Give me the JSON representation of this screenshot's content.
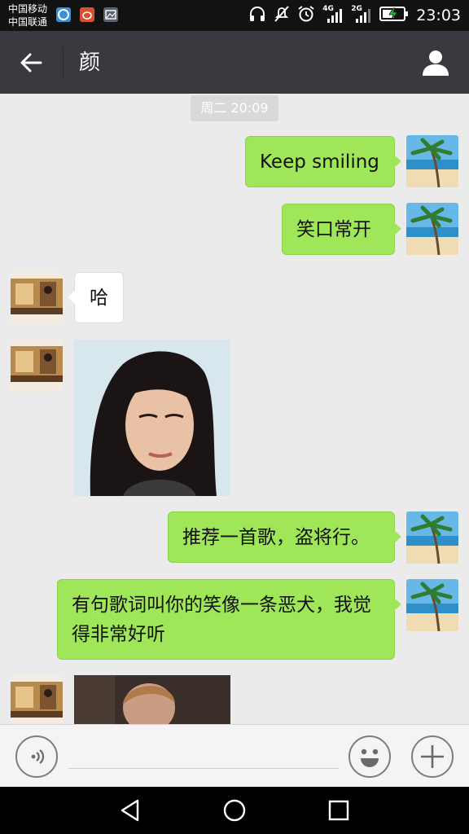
{
  "status_bar": {
    "carrier_1": "中国移动",
    "carrier_2": "中国联通",
    "network_1": "4G",
    "network_2": "2G",
    "time": "23:03",
    "icons": [
      "app-browser-icon",
      "app-weibo-icon",
      "app-gallery-icon",
      "headphones-icon",
      "mute-icon",
      "alarm-icon",
      "signal-icon",
      "battery-charging-icon"
    ]
  },
  "header": {
    "title": "颜",
    "back_icon": "arrow-left-icon",
    "profile_icon": "person-icon"
  },
  "chat": {
    "timestamp": "周二 20:09",
    "messages": [
      {
        "side": "out",
        "type": "text",
        "text": "Keep smiling"
      },
      {
        "side": "out",
        "type": "text",
        "text": "笑口常开"
      },
      {
        "side": "in",
        "type": "text",
        "text": "哈"
      },
      {
        "side": "in",
        "type": "image"
      },
      {
        "side": "out",
        "type": "text",
        "text": "推荐一首歌，盗将行。"
      },
      {
        "side": "out",
        "type": "text",
        "text": "有句歌词叫你的笑像一条恶犬，我觉得非常好听"
      },
      {
        "side": "in",
        "type": "image"
      }
    ]
  },
  "input_bar": {
    "voice_icon": "voice-icon",
    "input_value": "",
    "emoji_icon": "emoji-icon",
    "more_icon": "plus-icon"
  },
  "nav_bar": {
    "icons": [
      "back-triangle-icon",
      "home-circle-icon",
      "recents-square-icon"
    ]
  },
  "colors": {
    "header_bg": "#393a3f",
    "chat_bg": "#ebebeb",
    "outgoing_bubble": "#9fe658",
    "incoming_bubble": "#ffffff"
  }
}
